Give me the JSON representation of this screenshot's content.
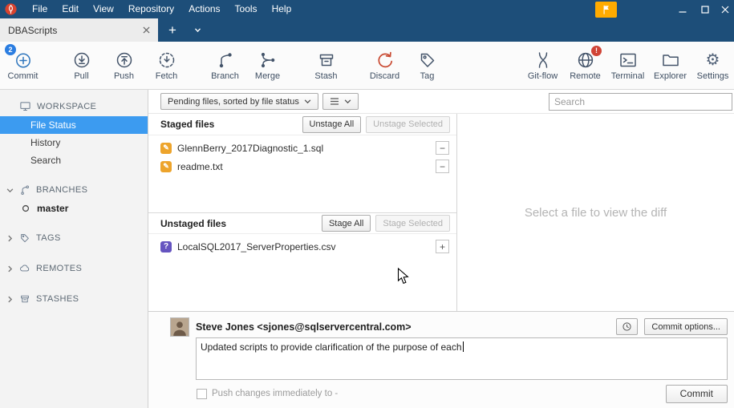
{
  "titlebar": {
    "menu": [
      "File",
      "Edit",
      "View",
      "Repository",
      "Actions",
      "Tools",
      "Help"
    ]
  },
  "tabbar": {
    "active_tab": "DBAScripts"
  },
  "toolbar": {
    "items": [
      {
        "label": "Commit",
        "badge": "2"
      },
      {
        "label": "Pull"
      },
      {
        "label": "Push"
      },
      {
        "label": "Fetch"
      },
      {
        "label": "Branch"
      },
      {
        "label": "Merge"
      },
      {
        "label": "Stash"
      },
      {
        "label": "Discard"
      },
      {
        "label": "Tag"
      },
      {
        "label": "Git-flow"
      },
      {
        "label": "Remote",
        "badge": "!"
      },
      {
        "label": "Terminal"
      },
      {
        "label": "Explorer"
      },
      {
        "label": "Settings"
      }
    ]
  },
  "sidebar": {
    "workspace": {
      "label": "WORKSPACE",
      "items": [
        {
          "label": "File Status",
          "selected": true
        },
        {
          "label": "History"
        },
        {
          "label": "Search"
        }
      ]
    },
    "branches": {
      "label": "BRANCHES",
      "items": [
        {
          "label": "master"
        }
      ]
    },
    "tags": {
      "label": "TAGS"
    },
    "remotes": {
      "label": "REMOTES"
    },
    "stashes": {
      "label": "STASHES"
    }
  },
  "filterbar": {
    "sort_dropdown": "Pending files, sorted by file status",
    "search_placeholder": "Search"
  },
  "staged": {
    "title": "Staged files",
    "unstage_all": "Unstage All",
    "unstage_selected": "Unstage Selected",
    "files": [
      {
        "name": "GlennBerry_2017Diagnostic_1.sql",
        "status": "modified"
      },
      {
        "name": "readme.txt",
        "status": "modified"
      }
    ]
  },
  "unstaged": {
    "title": "Unstaged files",
    "stage_all": "Stage All",
    "stage_selected": "Stage Selected",
    "files": [
      {
        "name": "LocalSQL2017_ServerProperties.csv",
        "status": "untracked"
      }
    ]
  },
  "diff_panel": {
    "placeholder": "Select a file to view the diff"
  },
  "commit_panel": {
    "author": "Steve Jones <sjones@sqlservercentral.com>",
    "options_button": "Commit options...",
    "message": "Updated scripts to provide clarification of the purpose of each",
    "push_label": "Push changes immediately to -",
    "commit_button": "Commit"
  },
  "colors": {
    "titlebar_blue": "#1d4e79",
    "selection_blue": "#3c9bf0",
    "modified_orange": "#eda42c",
    "untracked_purple": "#6554c0",
    "alert_red": "#d04437",
    "flag_amber": "#ffab00",
    "discard_red": "#c94a32"
  }
}
